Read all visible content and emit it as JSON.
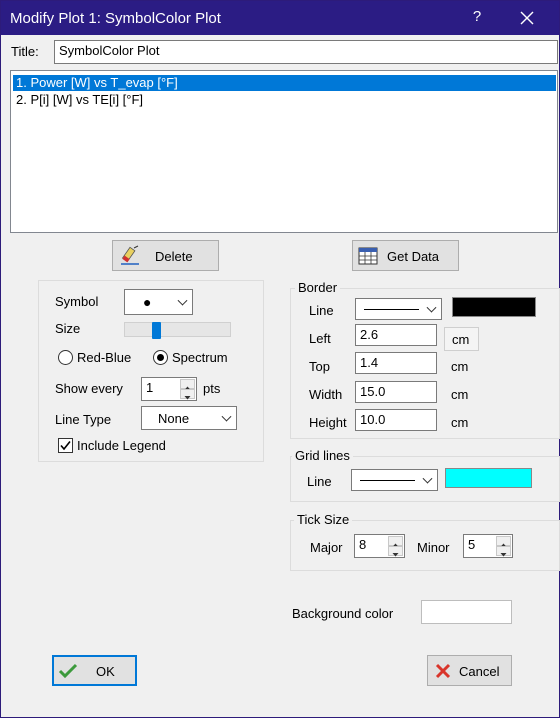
{
  "window": {
    "title": "Modify Plot 1: SymbolColor Plot",
    "help_glyph": "?"
  },
  "title_field": {
    "label": "Title:",
    "value": "SymbolColor Plot"
  },
  "plot_list": {
    "items": [
      {
        "label": "1.  Power [W] vs T_evap [°F]",
        "selected": true
      },
      {
        "label": "2.  P[i] [W] vs TE[i] [°F]",
        "selected": false
      }
    ]
  },
  "buttons": {
    "delete": "Delete",
    "get_data": "Get Data",
    "ok": "OK",
    "cancel": "Cancel"
  },
  "symbol_panel": {
    "symbol_label": "Symbol",
    "symbol_glyph": "●",
    "size_label": "Size",
    "size_level": 0.28,
    "red_blue_label": "Red-Blue",
    "spectrum_label": "Spectrum",
    "color_mode": "Spectrum",
    "show_every_label": "Show every",
    "show_every_value": "1",
    "pts_label": "pts",
    "line_type_label": "Line Type",
    "line_type_value": "None",
    "include_legend_label": "Include Legend",
    "include_legend_checked": true
  },
  "border": {
    "title": "Border",
    "line_label": "Line",
    "line_color": "#000000",
    "left_label": "Left",
    "left_value": "2.6",
    "top_label": "Top",
    "top_value": "1.4",
    "width_label": "Width",
    "width_value": "15.0",
    "height_label": "Height",
    "height_value": "10.0",
    "unit": "cm"
  },
  "grid_lines": {
    "title": "Grid lines",
    "line_label": "Line",
    "line_color": "#00ffff"
  },
  "tick_size": {
    "title": "Tick Size",
    "major_label": "Major",
    "major_value": "8",
    "minor_label": "Minor",
    "minor_value": "5"
  },
  "background": {
    "label": "Background color",
    "color": "#ffffff"
  },
  "colors": {
    "titlebar": "#2b1c84",
    "selection": "#0078d7",
    "ok_border": "#0078d7",
    "cancel_x": "#d9352b",
    "ok_check": "#3c9a3c"
  }
}
